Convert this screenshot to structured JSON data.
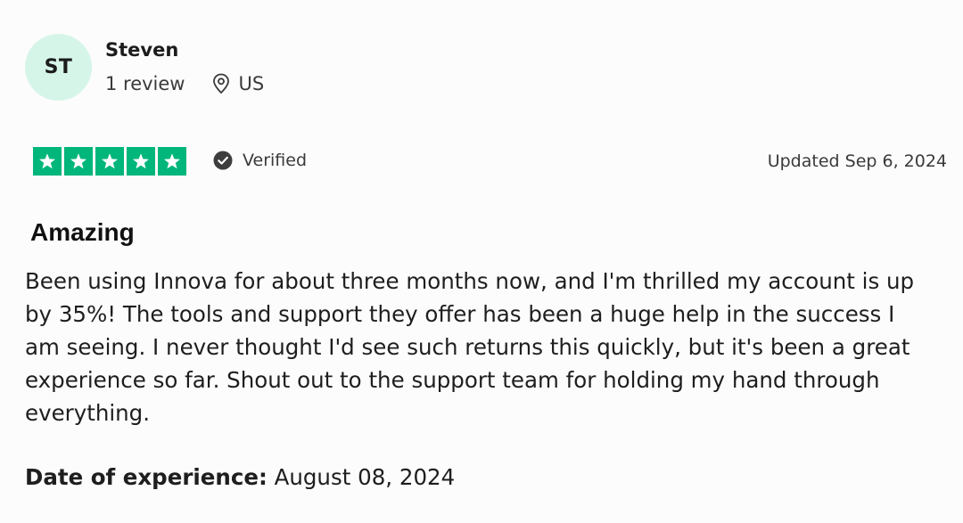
{
  "reviewer": {
    "initials": "ST",
    "name": "Steven",
    "review_count": "1 review",
    "country": "US",
    "location_icon": "location-pin-icon"
  },
  "rating": {
    "stars": 5,
    "max_stars": 5,
    "star_color": "#00b67a",
    "verified_label": "Verified",
    "verified_icon": "check-circle-icon"
  },
  "updated": "Updated Sep 6, 2024",
  "review": {
    "title": "Amazing",
    "body": "Been using Innova for about three months now, and I'm thrilled my account is up by 35%! The tools and support they offer has been a huge help in the success I am seeing. I never thought I'd see such returns this quickly, but it's been a great experience so far. Shout out to the support team for holding my hand through everything."
  },
  "experience": {
    "label": "Date of experience:",
    "date": "August 08, 2024"
  },
  "colors": {
    "avatar_bg": "#d6f5e9",
    "star_bg": "#00b67a"
  }
}
